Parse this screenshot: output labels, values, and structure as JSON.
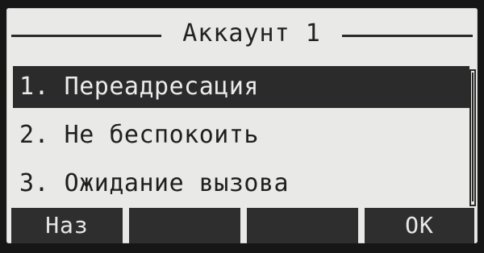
{
  "screen": {
    "title": "Аккаунт 1"
  },
  "menu": {
    "items": [
      {
        "label": "1. Переадресация",
        "selected": true
      },
      {
        "label": "2. Не беспокоить",
        "selected": false
      },
      {
        "label": "3. Ожидание вызова",
        "selected": false
      }
    ]
  },
  "softkeys": {
    "left": "Наз",
    "middle_left": "",
    "middle_right": "",
    "right": "OK"
  },
  "colors": {
    "lcd_background": "#e9e9e7",
    "selection_background": "#2b2b2b",
    "softkey_background": "#2e2e2e"
  }
}
